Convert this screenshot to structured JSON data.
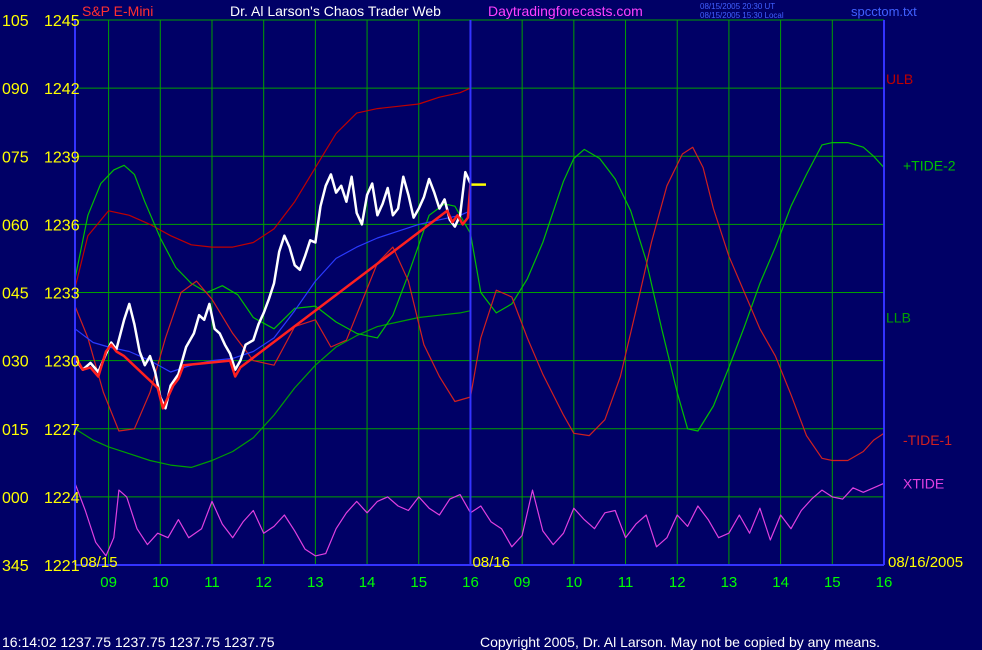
{
  "header": {
    "instrument": "S&P E-Mini",
    "title": "Dr. Al Larson's Chaos Trader Web",
    "site": "Daytradingforecasts.com",
    "stamp_ut": "08/15/2005 20:30 UT",
    "stamp_local": "08/15/2005 15:30 Local",
    "file": "spcctom.txt"
  },
  "footer": {
    "quote": "16:14:02  1237.75 1237.75 1237.75 1237.75",
    "copyright": "Copyright 2005, Dr. Al Larson. May not be copied by any means."
  },
  "colors": {
    "background": "#000066",
    "grid": "#00a000",
    "axis_blue": "#3333ff",
    "yellow": "#ffff00",
    "green_label": "#00ff00",
    "ulb": "#c00000",
    "llb": "#00a000",
    "tide_pos": "#00c000",
    "tide_neg": "#d02020",
    "xtide": "#e040e0",
    "white": "#ffffff",
    "magenta_text": "#ff40ff",
    "avg_blue": "#2a3aff"
  },
  "chart_data": {
    "type": "line",
    "title": "Dr. Al Larson's Chaos Trader Web",
    "subtitle": "S&P E-Mini",
    "y_left_labels": [
      {
        "angle": "105",
        "price": "1245"
      },
      {
        "angle": "090",
        "price": "1242"
      },
      {
        "angle": "075",
        "price": "1239"
      },
      {
        "angle": "060",
        "price": "1236"
      },
      {
        "angle": "045",
        "price": "1233"
      },
      {
        "angle": "030",
        "price": "1230"
      },
      {
        "angle": "015",
        "price": "1227"
      },
      {
        "angle": "000",
        "price": "1224"
      },
      {
        "angle": "345",
        "price": "1221"
      }
    ],
    "ylim": [
      1221,
      1245
    ],
    "xlim": [
      8.35,
      24.0
    ],
    "x_ticks": [
      {
        "x": 9,
        "label": "09"
      },
      {
        "x": 10,
        "label": "10"
      },
      {
        "x": 11,
        "label": "11"
      },
      {
        "x": 12,
        "label": "12"
      },
      {
        "x": 13,
        "label": "13"
      },
      {
        "x": 14,
        "label": "14"
      },
      {
        "x": 15,
        "label": "15"
      },
      {
        "x": 16,
        "label": "16"
      },
      {
        "x": 17,
        "label": "09"
      },
      {
        "x": 18,
        "label": "10"
      },
      {
        "x": 19,
        "label": "11"
      },
      {
        "x": 20,
        "label": "12"
      },
      {
        "x": 21,
        "label": "13"
      },
      {
        "x": 22,
        "label": "14"
      },
      {
        "x": 23,
        "label": "15"
      },
      {
        "x": 24,
        "label": "16"
      }
    ],
    "date_labels": [
      "08/15",
      "08/16",
      "08/16/2005"
    ],
    "day_divider_x": 16.0,
    "grid": true,
    "legend": [
      {
        "name": "ULB",
        "color": "#c00000",
        "y": 1242.4
      },
      {
        "name": "+TIDE-2",
        "color": "#00c000",
        "y": 1238.6
      },
      {
        "name": "LLB",
        "color": "#00a000",
        "y": 1231.9
      },
      {
        "name": "-TIDE-1",
        "color": "#d02020",
        "y": 1226.5
      },
      {
        "name": "XTIDE",
        "color": "#e040e0",
        "y": 1224.6
      }
    ],
    "series": [
      {
        "name": "ULB",
        "color": "#c00000",
        "x": [
          8.35,
          8.6,
          9.0,
          9.4,
          9.8,
          10.2,
          10.6,
          11.0,
          11.4,
          11.8,
          12.2,
          12.6,
          13.0,
          13.4,
          13.8,
          14.2,
          14.6,
          15.0,
          15.4,
          15.8,
          16.0
        ],
        "y": [
          1233.2,
          1235.5,
          1236.6,
          1236.4,
          1236.0,
          1235.5,
          1235.1,
          1235.0,
          1235.0,
          1235.2,
          1235.8,
          1237.0,
          1238.5,
          1240.0,
          1240.9,
          1241.1,
          1241.2,
          1241.3,
          1241.6,
          1241.8,
          1242.0
        ]
      },
      {
        "name": "LLB",
        "color": "#00a000",
        "x": [
          8.35,
          8.7,
          9.0,
          9.4,
          9.8,
          10.2,
          10.6,
          11.0,
          11.4,
          11.8,
          12.2,
          12.6,
          13.0,
          13.4,
          13.8,
          14.2,
          14.6,
          15.0,
          15.4,
          15.8,
          16.0
        ],
        "y": [
          1227.0,
          1226.5,
          1226.2,
          1225.9,
          1225.6,
          1225.4,
          1225.3,
          1225.6,
          1226.0,
          1226.6,
          1227.6,
          1228.8,
          1229.8,
          1230.6,
          1231.1,
          1231.5,
          1231.7,
          1231.9,
          1232.0,
          1232.1,
          1232.2
        ]
      },
      {
        "name": "+TIDE-2",
        "color": "#00c000",
        "x": [
          8.35,
          8.6,
          8.85,
          9.1,
          9.3,
          9.5,
          9.7,
          10.0,
          10.3,
          10.6,
          10.9,
          11.2,
          11.5,
          11.8,
          12.2,
          12.6,
          13.0,
          13.4,
          13.8,
          14.2,
          14.5,
          14.8,
          15.0,
          15.2,
          15.5,
          15.7,
          16.0,
          16.2,
          16.5,
          16.8,
          17.1,
          17.4,
          17.8,
          18.0,
          18.2,
          18.5,
          18.8,
          19.1,
          19.4,
          19.7,
          20.0,
          20.2,
          20.4,
          20.7,
          21.0,
          21.3,
          21.6,
          21.9,
          22.2,
          22.5,
          22.8,
          23.0,
          23.3,
          23.6,
          23.8,
          24.0
        ],
        "y": [
          1233.6,
          1236.4,
          1237.8,
          1238.4,
          1238.6,
          1238.2,
          1237.0,
          1235.4,
          1234.1,
          1233.4,
          1233.0,
          1233.3,
          1232.9,
          1231.9,
          1231.4,
          1232.3,
          1232.4,
          1231.7,
          1231.2,
          1231.0,
          1232.0,
          1233.8,
          1235.1,
          1236.4,
          1236.9,
          1236.8,
          1235.6,
          1233.0,
          1232.1,
          1232.5,
          1233.6,
          1235.2,
          1237.9,
          1238.9,
          1239.3,
          1238.9,
          1238.0,
          1236.6,
          1234.4,
          1231.4,
          1228.6,
          1227.0,
          1226.9,
          1228.0,
          1229.7,
          1231.5,
          1233.4,
          1235.0,
          1236.8,
          1238.2,
          1239.5,
          1239.6,
          1239.6,
          1239.4,
          1239.0,
          1238.5
        ]
      },
      {
        "name": "-TIDE-1",
        "color": "#d02020",
        "x": [
          8.35,
          8.6,
          8.9,
          9.2,
          9.5,
          9.8,
          10.1,
          10.4,
          10.7,
          11.0,
          11.4,
          11.8,
          12.2,
          12.6,
          13.0,
          13.3,
          13.6,
          13.9,
          14.2,
          14.5,
          14.8,
          15.1,
          15.4,
          15.7,
          16.0,
          16.2,
          16.5,
          16.8,
          17.1,
          17.4,
          17.8,
          18.0,
          18.3,
          18.6,
          18.9,
          19.2,
          19.5,
          19.8,
          20.1,
          20.3,
          20.5,
          20.7,
          21.0,
          21.3,
          21.6,
          21.9,
          22.2,
          22.5,
          22.8,
          23.0,
          23.3,
          23.6,
          23.8,
          24.0
        ],
        "y": [
          1232.4,
          1231.0,
          1228.6,
          1226.9,
          1227.0,
          1228.6,
          1231.0,
          1233.0,
          1233.5,
          1232.7,
          1231.2,
          1230.0,
          1229.8,
          1231.5,
          1231.8,
          1230.6,
          1230.9,
          1232.6,
          1234.3,
          1235.0,
          1233.5,
          1230.7,
          1229.3,
          1228.2,
          1228.4,
          1231.0,
          1233.1,
          1232.8,
          1231.0,
          1229.4,
          1227.6,
          1226.8,
          1226.7,
          1227.4,
          1229.3,
          1232.2,
          1235.2,
          1237.7,
          1239.1,
          1239.4,
          1238.5,
          1236.7,
          1234.6,
          1233.0,
          1231.4,
          1230.2,
          1228.5,
          1226.7,
          1225.7,
          1225.6,
          1225.6,
          1226.0,
          1226.5,
          1226.8
        ]
      },
      {
        "name": "XTIDE",
        "color": "#e040e0",
        "x": [
          8.35,
          8.55,
          8.75,
          8.95,
          9.1,
          9.2,
          9.35,
          9.55,
          9.75,
          9.95,
          10.15,
          10.35,
          10.55,
          10.8,
          11.0,
          11.2,
          11.4,
          11.6,
          11.8,
          12.0,
          12.2,
          12.4,
          12.6,
          12.8,
          13.0,
          13.2,
          13.4,
          13.6,
          13.8,
          14.0,
          14.2,
          14.4,
          14.6,
          14.8,
          15.0,
          15.2,
          15.4,
          15.6,
          15.8,
          16.0,
          16.2,
          16.4,
          16.6,
          16.8,
          17.0,
          17.2,
          17.4,
          17.6,
          17.8,
          18.0,
          18.2,
          18.4,
          18.6,
          18.8,
          19.0,
          19.2,
          19.4,
          19.6,
          19.8,
          20.0,
          20.2,
          20.4,
          20.6,
          20.8,
          21.0,
          21.2,
          21.4,
          21.6,
          21.8,
          22.0,
          22.2,
          22.4,
          22.6,
          22.8,
          23.0,
          23.2,
          23.4,
          23.6,
          23.8,
          24.0
        ],
        "y": [
          1224.6,
          1223.4,
          1222.0,
          1221.4,
          1222.2,
          1224.3,
          1224.0,
          1222.6,
          1221.9,
          1222.4,
          1222.2,
          1223.0,
          1222.2,
          1222.6,
          1223.8,
          1222.8,
          1222.2,
          1222.9,
          1223.4,
          1222.4,
          1222.7,
          1223.2,
          1222.5,
          1221.7,
          1221.4,
          1221.5,
          1222.6,
          1223.3,
          1223.8,
          1223.3,
          1223.8,
          1224.0,
          1223.6,
          1223.4,
          1224.0,
          1223.5,
          1223.2,
          1223.9,
          1224.1,
          1223.3,
          1223.6,
          1222.9,
          1222.6,
          1221.8,
          1222.3,
          1224.3,
          1222.5,
          1221.9,
          1222.4,
          1223.5,
          1223.0,
          1222.6,
          1223.3,
          1223.4,
          1222.2,
          1222.8,
          1223.2,
          1221.8,
          1222.2,
          1223.2,
          1222.7,
          1223.6,
          1223.0,
          1222.2,
          1222.4,
          1223.2,
          1222.4,
          1223.5,
          1222.1,
          1223.2,
          1222.6,
          1223.4,
          1223.9,
          1224.3,
          1224.0,
          1223.9,
          1224.4,
          1224.2,
          1224.4,
          1224.6
        ]
      },
      {
        "name": "average",
        "color": "#2a3aff",
        "x": [
          8.35,
          8.7,
          9.0,
          9.4,
          9.8,
          10.2,
          10.6,
          11.0,
          11.4,
          11.8,
          12.2,
          12.6,
          13.0,
          13.4,
          13.8,
          14.2,
          14.6,
          15.0,
          15.4,
          15.8,
          16.0
        ],
        "y": [
          1231.4,
          1230.8,
          1230.6,
          1230.4,
          1230.0,
          1229.5,
          1229.8,
          1230.0,
          1230.1,
          1230.4,
          1231.0,
          1232.2,
          1233.5,
          1234.5,
          1235.0,
          1235.4,
          1235.7,
          1236.0,
          1236.2,
          1236.4,
          1236.6
        ]
      },
      {
        "name": "price",
        "color": "#ffffff",
        "x": [
          8.35,
          8.5,
          8.65,
          8.8,
          8.95,
          9.05,
          9.15,
          9.3,
          9.4,
          9.5,
          9.6,
          9.7,
          9.8,
          9.9,
          10.0,
          10.1,
          10.2,
          10.35,
          10.5,
          10.65,
          10.75,
          10.85,
          10.95,
          11.05,
          11.15,
          11.25,
          11.35,
          11.45,
          11.55,
          11.65,
          11.8,
          11.9,
          12.0,
          12.1,
          12.2,
          12.3,
          12.4,
          12.5,
          12.6,
          12.7,
          12.8,
          12.9,
          13.0,
          13.1,
          13.2,
          13.3,
          13.4,
          13.5,
          13.6,
          13.7,
          13.8,
          13.9,
          14.0,
          14.1,
          14.2,
          14.3,
          14.4,
          14.5,
          14.6,
          14.7,
          14.8,
          14.9,
          15.0,
          15.1,
          15.2,
          15.3,
          15.4,
          15.5,
          15.6,
          15.7,
          15.8,
          15.9,
          16.0
        ],
        "y": [
          1230.1,
          1229.6,
          1229.9,
          1229.5,
          1230.3,
          1230.8,
          1230.5,
          1231.8,
          1232.5,
          1231.6,
          1230.4,
          1229.8,
          1230.2,
          1229.5,
          1228.4,
          1227.9,
          1228.9,
          1229.4,
          1230.6,
          1231.2,
          1232.0,
          1231.8,
          1232.5,
          1231.4,
          1231.2,
          1230.7,
          1230.3,
          1229.6,
          1230.0,
          1230.7,
          1230.9,
          1231.6,
          1232.1,
          1232.7,
          1233.4,
          1234.8,
          1235.5,
          1235.0,
          1234.2,
          1234.0,
          1234.6,
          1235.3,
          1235.2,
          1236.8,
          1237.7,
          1238.2,
          1237.4,
          1237.7,
          1237.0,
          1238.1,
          1236.5,
          1236.0,
          1237.3,
          1237.8,
          1236.4,
          1236.9,
          1237.6,
          1236.4,
          1236.7,
          1238.1,
          1237.3,
          1236.3,
          1236.7,
          1237.2,
          1238.0,
          1237.4,
          1236.7,
          1237.1,
          1236.2,
          1235.9,
          1236.4,
          1238.3,
          1237.8
        ]
      },
      {
        "name": "price-red",
        "color": "#ff2020",
        "x": [
          8.35,
          8.5,
          8.65,
          8.8,
          8.95,
          9.05,
          9.15,
          9.3,
          9.95,
          10.05,
          10.15,
          10.25,
          10.35,
          10.45,
          11.35,
          11.45,
          11.55,
          15.55,
          15.65,
          15.75,
          15.85,
          15.95,
          16.0
        ],
        "y": [
          1230.2,
          1229.6,
          1229.7,
          1229.3,
          1230.4,
          1230.7,
          1230.4,
          1230.2,
          1228.8,
          1227.9,
          1228.4,
          1228.9,
          1229.2,
          1229.8,
          1230.0,
          1229.3,
          1229.7,
          1236.6,
          1236.1,
          1236.4,
          1236.0,
          1236.3,
          1237.8
        ]
      },
      {
        "name": "price-close",
        "color": "#ffff00",
        "x": [
          16.0,
          16.1,
          16.2,
          16.3
        ],
        "y": [
          1237.75,
          1237.75,
          1237.75,
          1237.75
        ]
      }
    ]
  }
}
